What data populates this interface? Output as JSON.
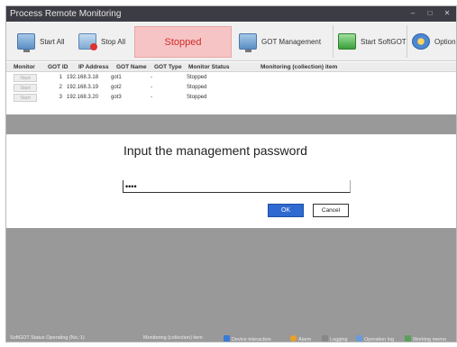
{
  "window": {
    "title": "Process Remote Monitoring"
  },
  "toolbar": {
    "start_all": "Start All",
    "stop_all": "Stop All",
    "status": "Stopped",
    "got_management": "GOT Management",
    "start_softgot": "Start SoftGOT",
    "option": "Option"
  },
  "grid": {
    "columns": [
      "Monitor",
      "GOT ID",
      "IP Address",
      "GOT Name",
      "GOT Type",
      "Monitor Status",
      "Monitoring (collection) item"
    ],
    "rows": [
      {
        "monitor": "Start",
        "got_id": "1",
        "ip": "192.168.3.18",
        "name": "got1",
        "type": "-",
        "status": "Stopped"
      },
      {
        "monitor": "Start",
        "got_id": "2",
        "ip": "192.168.3.19",
        "name": "got2",
        "type": "-",
        "status": "Stopped"
      },
      {
        "monitor": "Start",
        "got_id": "3",
        "ip": "192.168.3.20",
        "name": "got3",
        "type": "-",
        "status": "Stopped"
      }
    ]
  },
  "dialog": {
    "title": "Input the management password",
    "password_value": "pass",
    "ok_label": "OK",
    "cancel_label": "Cancel"
  },
  "statusbar": {
    "softgot_status": "SoftGOT Status Operating (No.:1)",
    "monitoring_item": "Monitoring (collection) item",
    "device_interaction": "Device interaction",
    "alarm": "Alarm",
    "logging": "Logging",
    "operation_log": "Operation log",
    "working_memo": "Working memo"
  },
  "colors": {
    "accent": "#2f6ad1",
    "stopped": "#d12b2b",
    "stopped_bg": "#f6c4c4",
    "titlebar": "#3c3c44"
  }
}
